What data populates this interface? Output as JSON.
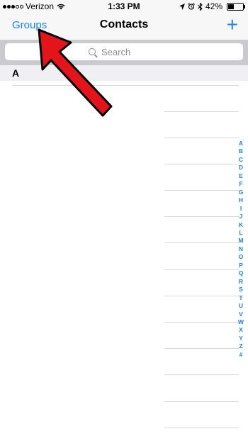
{
  "status_bar": {
    "carrier": "Verizon",
    "time": "1:33 PM",
    "battery_percent": "42%",
    "battery_level": 0.42,
    "icons": [
      "location-icon",
      "alarm-icon",
      "bluetooth-icon",
      "wifi-icon"
    ]
  },
  "nav": {
    "groups_label": "Groups",
    "title": "Contacts",
    "add_label": "+"
  },
  "search": {
    "placeholder": "Search"
  },
  "section": {
    "letter": "A"
  },
  "index_letters": [
    "A",
    "B",
    "C",
    "D",
    "E",
    "F",
    "G",
    "H",
    "I",
    "J",
    "K",
    "L",
    "M",
    "N",
    "O",
    "P",
    "Q",
    "R",
    "S",
    "T",
    "U",
    "V",
    "W",
    "X",
    "Y",
    "Z",
    "#"
  ],
  "colors": {
    "accent": "#1a82fb",
    "annotation_arrow": "#e3151a"
  }
}
